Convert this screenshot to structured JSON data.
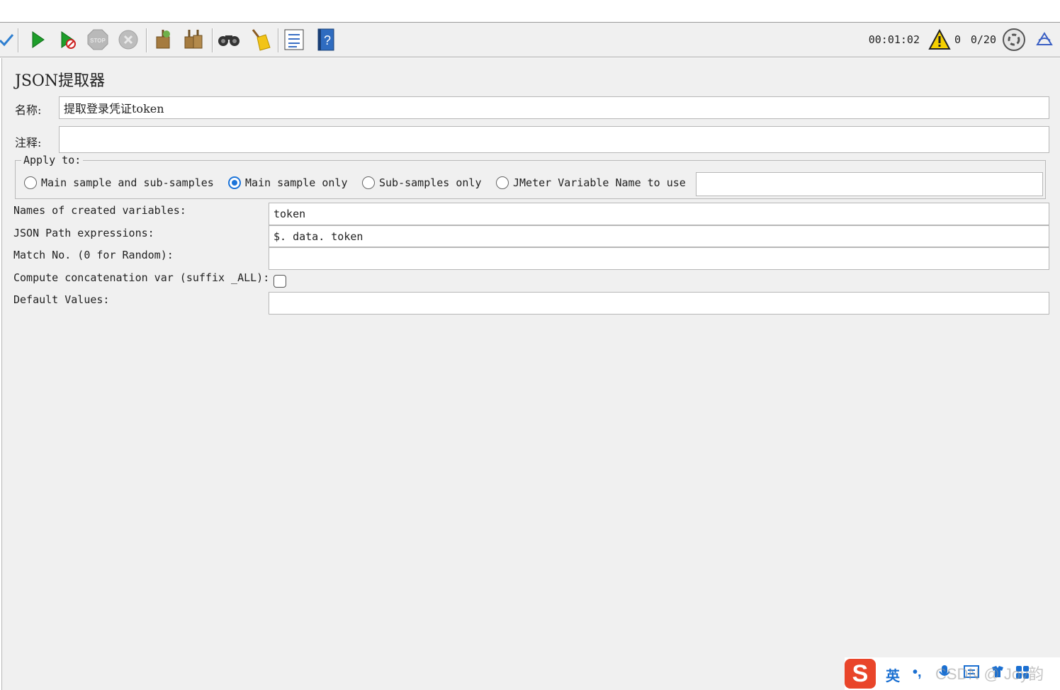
{
  "toolbar": {
    "timer": "00:01:02",
    "warning_count": "0",
    "threads": "0/20"
  },
  "panel": {
    "title": "JSON提取器",
    "name_label": "名称:",
    "name_value": "提取登录凭证token",
    "comment_label": "注释:",
    "comment_value": "",
    "apply_to": {
      "legend": "Apply to:",
      "options": [
        {
          "label": "Main sample and sub-samples",
          "selected": false
        },
        {
          "label": "Main sample only",
          "selected": true
        },
        {
          "label": "Sub-samples only",
          "selected": false
        },
        {
          "label": "JMeter Variable Name to use",
          "selected": false
        }
      ],
      "variable_value": ""
    },
    "fields": {
      "names_label": "Names of created variables:",
      "names_value": "token",
      "json_path_label": "JSON Path expressions:",
      "json_path_value": "$. data. token",
      "match_label": "Match No. (0 for Random):",
      "match_value": "",
      "concat_label": "Compute concatenation var (suffix _ALL):",
      "concat_checked": false,
      "default_label": "Default Values:",
      "default_value": ""
    }
  },
  "ime_bar": {
    "logo": "S",
    "lang": "英",
    "punct": "•,",
    "watermark": "CSDN @ Joy韵"
  },
  "colors": {
    "panel_bg": "#f0f0f0",
    "accent": "#1c74d9",
    "ime_red": "#e9452a"
  }
}
